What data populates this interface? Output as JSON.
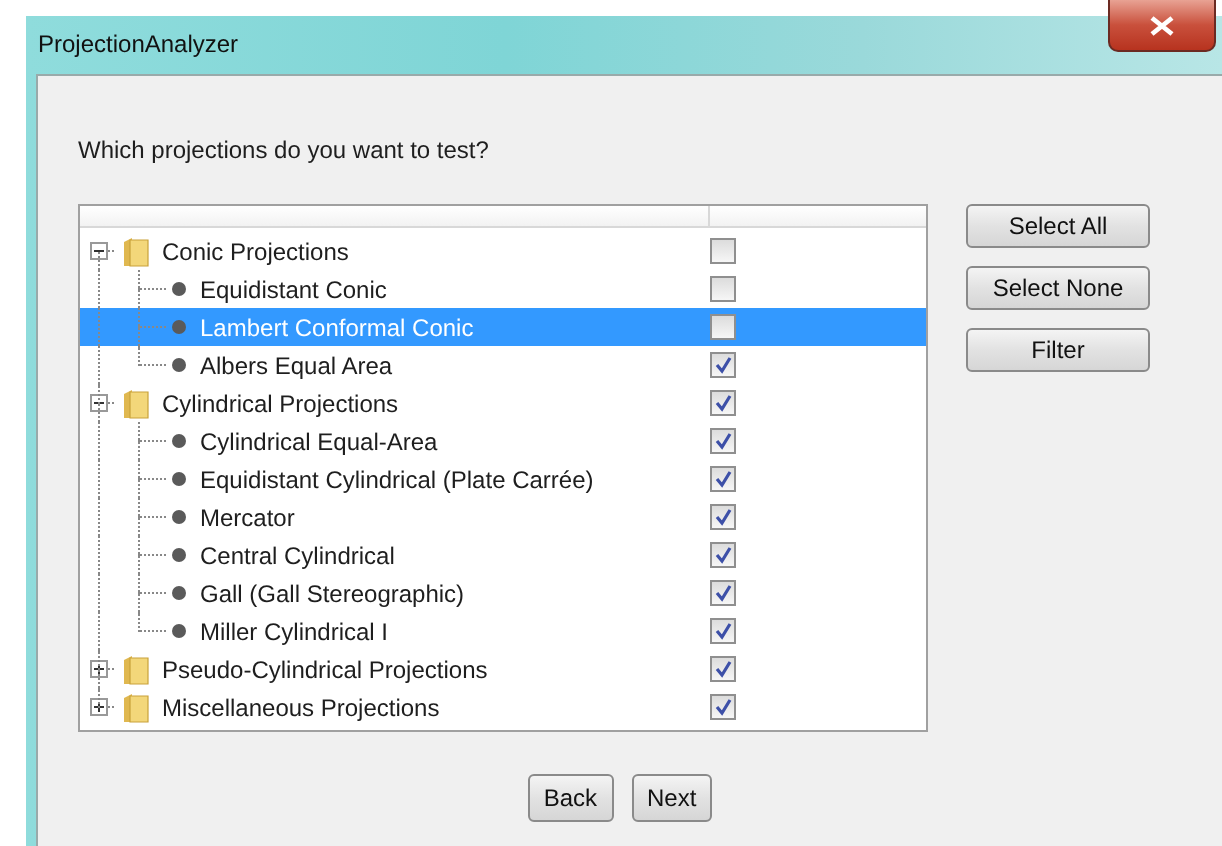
{
  "window": {
    "title": "ProjectionAnalyzer"
  },
  "prompt": "Which projections do you want to test?",
  "tree": [
    {
      "label": "Conic Projections",
      "expanded": true,
      "checked": false,
      "selected": false,
      "children": [
        {
          "label": "Equidistant Conic",
          "checked": false,
          "selected": false
        },
        {
          "label": "Lambert Conformal Conic",
          "checked": false,
          "selected": true
        },
        {
          "label": "Albers Equal Area",
          "checked": true,
          "selected": false
        }
      ]
    },
    {
      "label": "Cylindrical Projections",
      "expanded": true,
      "checked": true,
      "selected": false,
      "children": [
        {
          "label": "Cylindrical Equal-Area",
          "checked": true,
          "selected": false
        },
        {
          "label": "Equidistant Cylindrical (Plate Carrée)",
          "checked": true,
          "selected": false
        },
        {
          "label": "Mercator",
          "checked": true,
          "selected": false
        },
        {
          "label": "Central Cylindrical",
          "checked": true,
          "selected": false
        },
        {
          "label": "Gall (Gall Stereographic)",
          "checked": true,
          "selected": false
        },
        {
          "label": "Miller Cylindrical I",
          "checked": true,
          "selected": false
        }
      ]
    },
    {
      "label": "Pseudo-Cylindrical Projections",
      "expanded": false,
      "checked": true,
      "selected": false
    },
    {
      "label": "Miscellaneous Projections",
      "expanded": false,
      "checked": true,
      "selected": false
    }
  ],
  "side_buttons": [
    "Select All",
    "Select None",
    "Filter"
  ],
  "nav_buttons": [
    "Back",
    "Next"
  ]
}
